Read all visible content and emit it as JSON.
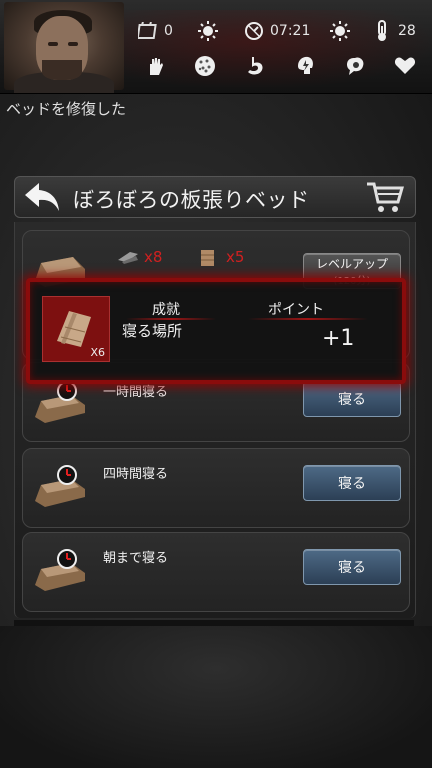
{
  "status_bar": {
    "day_count": "0",
    "time": "07:21",
    "temperature": "28",
    "icons": [
      "calendar-icon",
      "sun-icon",
      "clock-icon",
      "sun-icon",
      "thermometer-icon"
    ],
    "need_icons": [
      "hand-icon",
      "virus-icon",
      "stomach-icon",
      "energy-icon",
      "mental-icon",
      "heart-icon"
    ]
  },
  "message": "ベッドを修復した",
  "panel": {
    "title": "ぼろぼろの板張りベッド",
    "upgrade": {
      "resource1_count": "x8",
      "resource2_count": "x5",
      "button_label": "レベルアップ",
      "button_sub": "(120分)"
    },
    "actions": [
      {
        "label": "一時間寝る",
        "button": "寝る"
      },
      {
        "label": "四時間寝る",
        "button": "寝る"
      },
      {
        "label": "朝まで寝る",
        "button": "寝る"
      }
    ]
  },
  "achievement": {
    "header_achievement": "成就",
    "header_points": "ポイント",
    "name": "寝る場所",
    "count": "X6",
    "points": "+1"
  },
  "colors": {
    "accent_red": "#a01414",
    "button_blue": "#3d5570"
  }
}
